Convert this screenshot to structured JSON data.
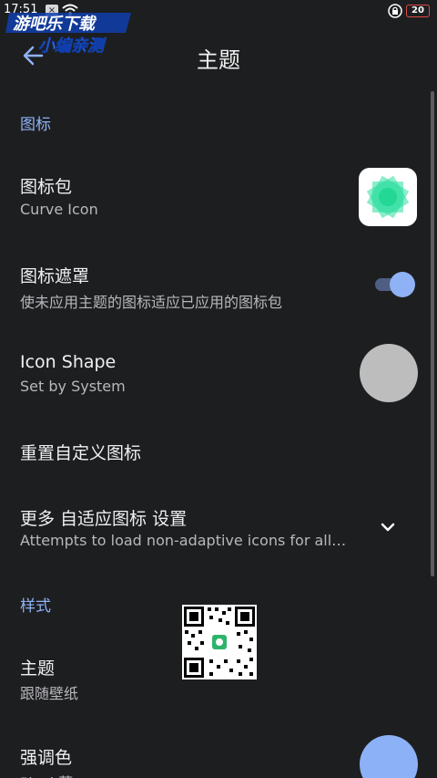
{
  "status_bar": {
    "time": "17:51",
    "notification_badge": "×",
    "battery_level": "20"
  },
  "watermark": {
    "line1": "游吧乐下载",
    "line2": "小编亲测"
  },
  "header": {
    "title": "主题",
    "back_icon": "arrow-back-icon"
  },
  "colors": {
    "background": "#1d1e20",
    "accent": "#8fb2f6",
    "primary_text": "#f0f0f0",
    "secondary_text": "#b8b8bc",
    "icon_pack_green": "#2fdfa0",
    "shape_preview": "#bdbdbd",
    "accent_preview": "#8db1f7"
  },
  "sections": {
    "icons": {
      "header": "图标",
      "icon_pack": {
        "title": "图标包",
        "subtitle": "Curve Icon"
      },
      "icon_mask": {
        "title": "图标遮罩",
        "subtitle": "使未应用主题的图标适应已应用的图标包",
        "enabled": true
      },
      "icon_shape": {
        "title": "Icon Shape",
        "subtitle": "Set by System"
      },
      "reset_icons": {
        "title": "重置自定义图标"
      },
      "more_adaptive": {
        "title": "更多 自适应图标 设置",
        "subtitle": "Attempts to load non-adaptive icons for all…"
      }
    },
    "style": {
      "header": "样式",
      "theme": {
        "title": "主题",
        "subtitle": "跟随壁纸"
      },
      "accent_color": {
        "title": "强调色",
        "subtitle": "Pixel 蓝"
      }
    }
  }
}
